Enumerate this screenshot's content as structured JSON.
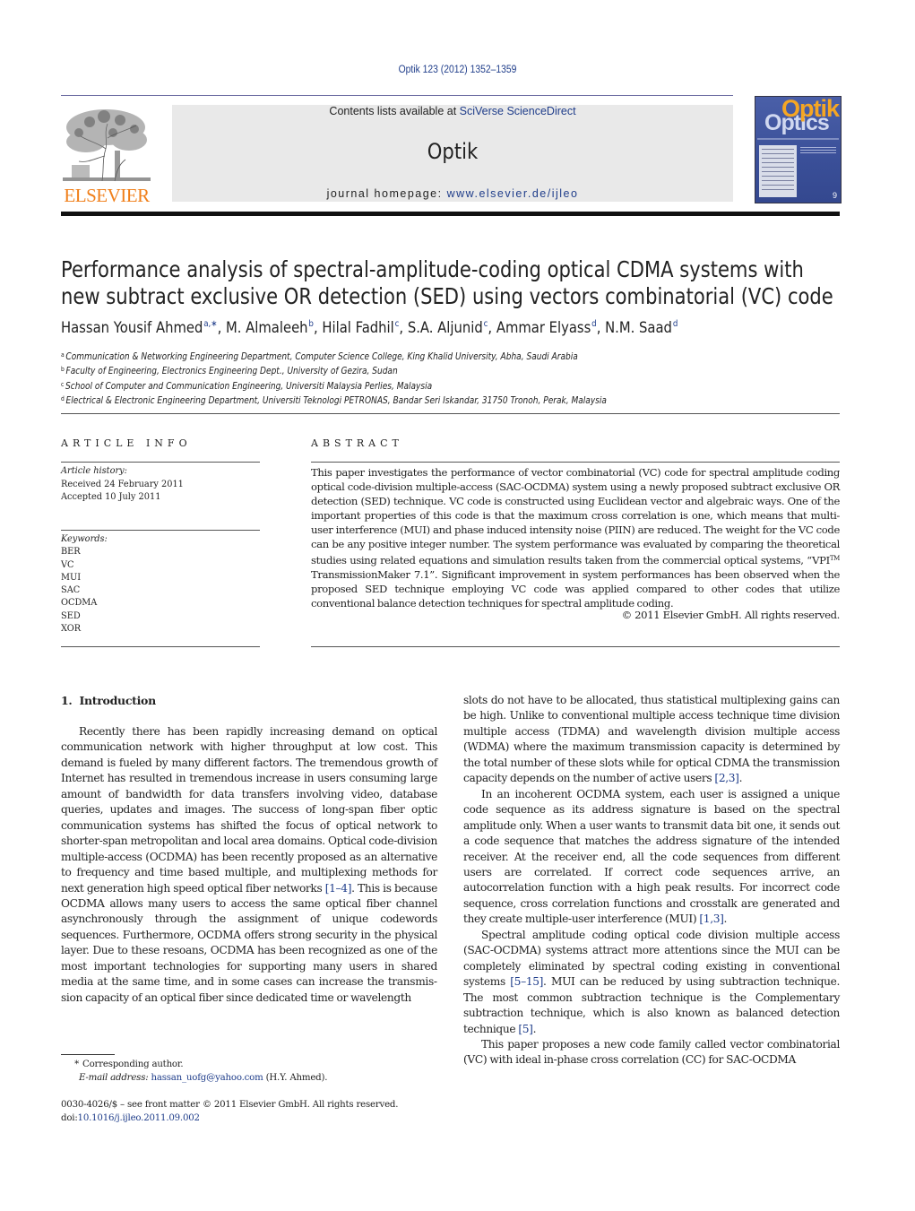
{
  "header": {
    "citation": "Optik 123 (2012) 1352–1359",
    "publisher_logo_text": "ELSEVIER",
    "contents_prefix": "Contents lists available at ",
    "contents_link": "SciVerse ScienceDirect",
    "journal_title": "Optik",
    "homepage_prefix": "journal homepage: ",
    "homepage_link": "www.elsevier.de/ijleo",
    "cover": {
      "title_primary": "Optik",
      "title_secondary": "Optics",
      "issue_number": "9"
    }
  },
  "article": {
    "title_line1": "Performance analysis of spectral-amplitude-coding optical CDMA systems with",
    "title_line2": "new subtract exclusive OR detection (SED) using vectors combinatorial (VC) code",
    "authors": [
      {
        "name": "Hassan Yousif Ahmed",
        "affil": "a,∗",
        "sep": ", "
      },
      {
        "name": "M. Almaleeh",
        "affil": "b",
        "sep": ", "
      },
      {
        "name": "Hilal Fadhil",
        "affil": "c",
        "sep": ", "
      },
      {
        "name": "S.A. Aljunid",
        "affil": "c",
        "sep": ", "
      },
      {
        "name": "Ammar Elyass",
        "affil": "d",
        "sep": ", "
      },
      {
        "name": "N.M. Saad",
        "affil": "d",
        "sep": ""
      }
    ],
    "affiliations": [
      {
        "key": "a",
        "text": "Communication & Networking Engineering Department, Computer Science College, King Khalid University, Abha, Saudi Arabia"
      },
      {
        "key": "b",
        "text": "Faculty of Engineering, Electronics Engineering Dept., University of Gezira, Sudan"
      },
      {
        "key": "c",
        "text": "School of Computer and Communication Engineering, Universiti Malaysia Perlies, Malaysia"
      },
      {
        "key": "d",
        "text": "Electrical & Electronic Engineering Department, Universiti Teknologi PETRONAS, Bandar Seri Iskandar, 31750 Tronoh, Perak, Malaysia"
      }
    ]
  },
  "article_info": {
    "heading": "ARTICLE INFO",
    "history_label": "Article history:",
    "received": "Received 24 February 2011",
    "accepted": "Accepted 10 July 2011",
    "keywords_label": "Keywords:",
    "keywords": [
      "BER",
      "VC",
      "MUI",
      "SAC",
      "OCDMA",
      "SED",
      "XOR"
    ]
  },
  "abstract": {
    "heading": "ABSTRACT",
    "text_before_sup": "This paper investigates the performance of vector combinatorial (VC) code for spectral amplitude coding optical code-division multiple-access (SAC-OCDMA) system using a newly proposed subtract exclusive OR detection (SED) technique. VC code is constructed using Euclidean vector and algebraic ways. One of the important properties of this code is that the maximum cross correlation is one, which means that multi-user interference (MUI) and phase induced intensity noise (PIIN) are reduced. The weight for the VC code can be any positive integer number. The system performance was evaluated by comparing the theoretical studies using related equations and simulation results taken from the commercial optical systems, “VPI",
    "sup": "TM",
    "text_after_sup": " TransmissionMaker 7.1”. Significant improvement in system performances has been observed when the proposed SED technique employing VC code was applied compared to other codes that utilize conventional balance detection techniques for spectral amplitude coding.",
    "copyright": "© 2011 Elsevier GmbH. All rights reserved."
  },
  "body": {
    "section_number": "1.",
    "section_title": "Introduction",
    "left": {
      "p1_a": "Recently there has been rapidly increasing demand on opti­cal communication network with higher throughput at low cost. This demand is fueled by many different factors. The tremen­dous growth of Internet has resulted in tremendous increase in users consuming large amount of bandwidth for data transfers involving video, database queries, updates and images. The suc­cess of long-span fiber optic communication systems has shifted the focus of optical network to shorter-span metropolitan and local area domains. Optical code-division multiple-access (OCDMA) has been recently proposed as an alternative to frequency and time based multiple, and multiplexing methods for next generation high speed optical fiber networks ",
      "p1_ref": "[1–4]",
      "p1_b": ". This is because OCDMA allows many users to access the same optical fiber channel asynchronously through the assignment of unique codewords sequences. Further­more, OCDMA offers strong security in the physical layer. Due to these resoans, OCDMA has been recognized as one of the most important technologies for supporting many users in shared media at the same time, and in some cases can increase the transmis­sion capacity of an optical fiber since dedicated time or wavelength"
    },
    "right": {
      "p1_a": "slots do not have to be allocated, thus statistical multiplexing gains can be high. Unlike to conventional multiple access technique time division multiple access (TDMA) and wavelength division multi­ple access (WDMA) where the maximum transmission capacity is determined by the total number of these slots while for optical CDMA the transmission capacity depends on the number of active users ",
      "p1_ref": "[2,3]",
      "p1_b": ".",
      "p2_a": "In an incoherent OCDMA system, each user is assigned a unique code sequence as its address signature is based on the spectral amplitude only. When a user wants to transmit data bit one, it sends out a code sequence that matches the address signature of the intended receiver. At the receiver end, all the code sequences from different users are correlated. If correct code sequences arrive, an autocorrelation function with a high peak results. For incorrect code sequence, cross correlation functions and crosstalk are generated and they create multiple-user interference (MUI) ",
      "p2_ref": "[1,3]",
      "p2_b": ".",
      "p3_a": "Spectral amplitude coding optical code division multiple access (SAC-OCDMA) systems attract more attentions since the MUI can be completely eliminated by spectral coding existing in conven­tional systems ",
      "p3_ref": "[5–15]",
      "p3_b": ". MUI can be reduced by using subtraction technique. The most common subtraction technique is the Com­plementary subtraction technique, which is also known as balanced detection technique ",
      "p3_ref2": "[5]",
      "p3_c": ".",
      "p4": "This paper proposes a new code family called vector combinato­rial (VC) with ideal in-phase cross correlation (CC) for SAC-OCDMA"
    }
  },
  "footnotes": {
    "star": "*",
    "corresponding": "Corresponding author.",
    "email_label": "E-mail address:",
    "email": "hassan_uofg@yahoo.com",
    "email_suffix": " (H.Y. Ahmed).",
    "front_matter": "0030-4026/$ – see front matter © 2011 Elsevier GmbH. All rights reserved.",
    "doi_prefix": "doi:",
    "doi": "10.1016/j.ijleo.2011.09.002"
  },
  "colors": {
    "link": "#1f3d8a",
    "elsevier_orange": "#f07f1a",
    "banner_gray": "#e9e9e9",
    "cover_blue": "#3a4f98",
    "cover_orange": "#f5a623"
  }
}
